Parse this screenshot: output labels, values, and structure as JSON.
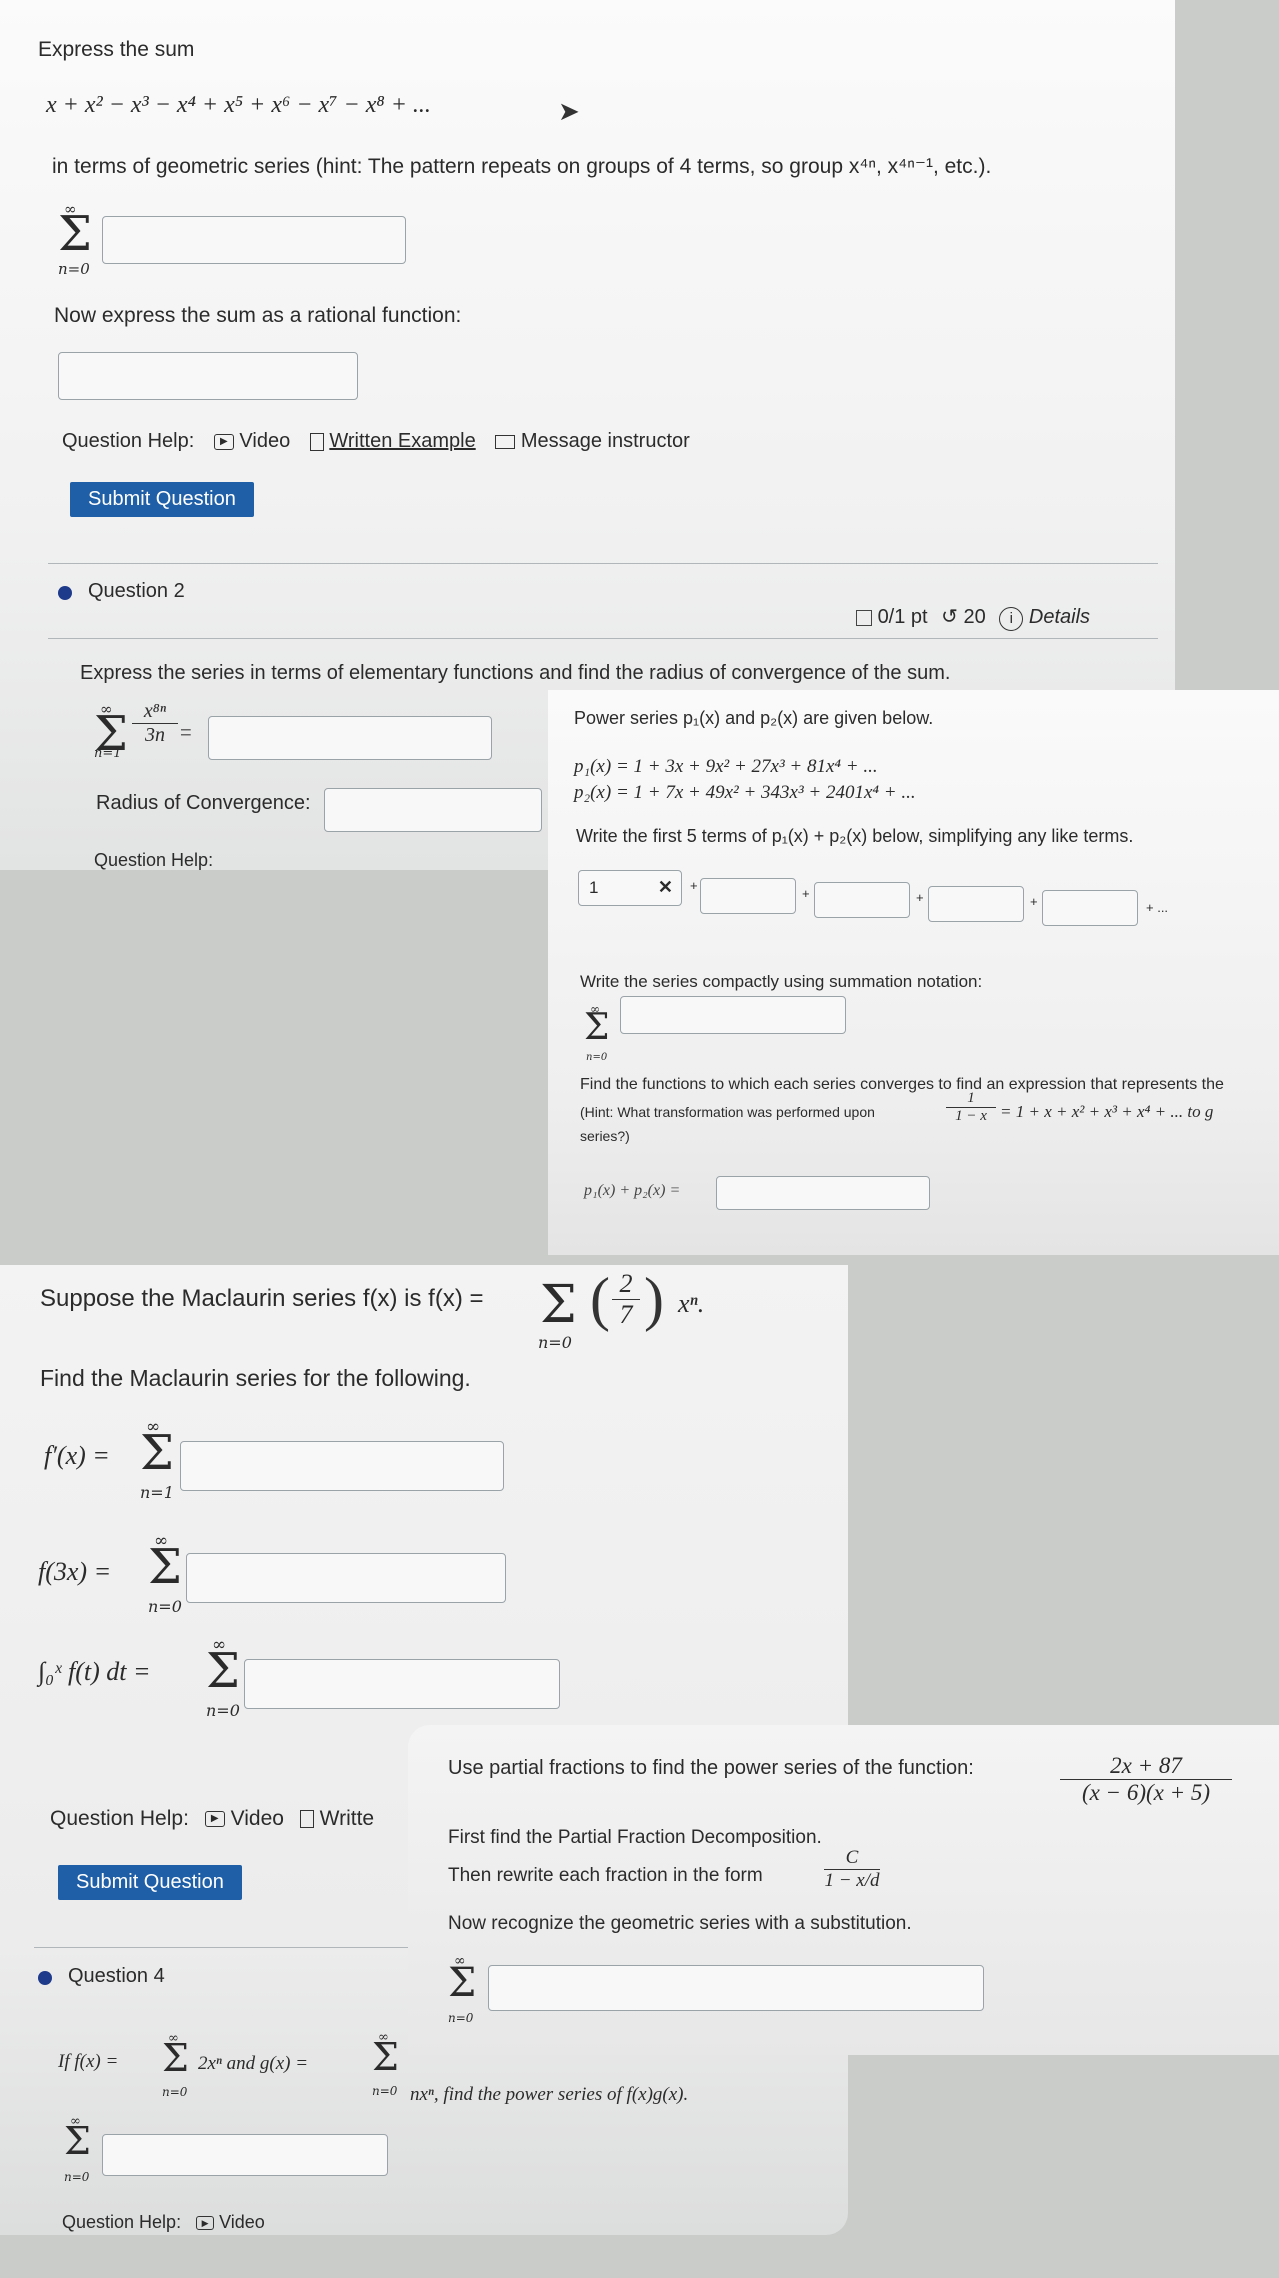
{
  "q1": {
    "intro": "Express the sum",
    "series_expr": "x + x² − x³ − x⁴ + x⁵ + x⁶ − x⁷ − x⁸ + ...",
    "hint": "in terms of geometric series (hint:  The pattern repeats on groups of 4 terms, so group x⁴ⁿ, x⁴ⁿ⁻¹, etc.).",
    "sum_top": "∞",
    "sum_bot": "n=0",
    "rational_prompt": "Now express the sum as a rational function:",
    "help_label": "Question Help:",
    "video_label": "Video",
    "written_label": "Written Example",
    "message_label": "Message instructor",
    "submit_label": "Submit Question"
  },
  "q2": {
    "title": "Question 2",
    "score": "0/1 pt",
    "attempts": "20",
    "details": "Details",
    "prompt": "Express the series in terms of elementary functions and find the radius of convergence of the sum.",
    "sum_top": "∞",
    "sum_bot": "n=1",
    "frac_num": "x⁸ⁿ",
    "frac_den": "3n",
    "radius_label": "Radius of Convergence:",
    "help_label": "Question Help:"
  },
  "power": {
    "intro": "Power series p₁(x) and p₂(x) are given below.",
    "p1": "p₁(x) = 1 + 3x + 9x² + 27x³ + 81x⁴ + ...",
    "p2": "p₂(x) = 1 + 7x + 49x² + 343x³ + 2401x⁴ + ...",
    "first5_prompt": "Write the first 5 terms of p₁(x) + p₂(x) below, simplifying any like terms.",
    "first_value": "1",
    "ellipsis": "+ ...",
    "compact_prompt": "Write the series compactly using summation notation:",
    "sum_top": "∞",
    "sum_bot": "n=0",
    "find_prompt": "Find the functions to which each series converges to find an expression that represents the",
    "hint_text": "(Hint: What transformation was performed upon",
    "hint_frac_num": "1",
    "hint_frac_den": "1 − x",
    "hint_tail": "= 1 + x + x² + x³ + x⁴ + ... to g",
    "series_word": "series?)",
    "sum_label": "p₁(x) + p₂(x) ="
  },
  "maclaurin": {
    "suppose": "Suppose the Maclaurin series f(x) is f(x) =",
    "sum_bot": "n=0",
    "frac_num": "2",
    "frac_den": "7",
    "xn": "xⁿ.",
    "find": "Find the Maclaurin series for the following.",
    "fprime": "f′(x) =",
    "fprime_bot": "n=1",
    "f3x": "f(3x) =",
    "f3x_bot": "n=0",
    "integral": "∫₀ˣ f(t) dt =",
    "int_bot": "n=0",
    "sum_top": "∞",
    "help_label": "Question Help:",
    "video_label": "Video",
    "written_label": "Writte",
    "submit_label": "Submit Question"
  },
  "q4": {
    "title": "Question 4",
    "prompt_a": "If f(x) =",
    "term_a": "2xⁿ  and  g(x) =",
    "prompt_b": "nxⁿ, find the power series of f(x)g(x).",
    "sum_top": "∞",
    "sum_bot": "n=0",
    "help_label": "Question Help:",
    "video_label": "Video"
  },
  "partial": {
    "prompt": "Use partial fractions to find the power series of the function:",
    "frac_num": "2x + 87",
    "frac_den": "(x − 6)(x + 5)",
    "step1": "First find the Partial Fraction Decomposition.",
    "step2": "Then rewrite each fraction in the form",
    "form_num": "C",
    "form_den": "1 − x/d",
    "step3": "Now recognize the geometric series with a substitution.",
    "sum_top": "∞",
    "sum_bot": "n=0"
  },
  "colors": {
    "accent": "#1f5fa8",
    "dot": "#1e3a8a"
  }
}
